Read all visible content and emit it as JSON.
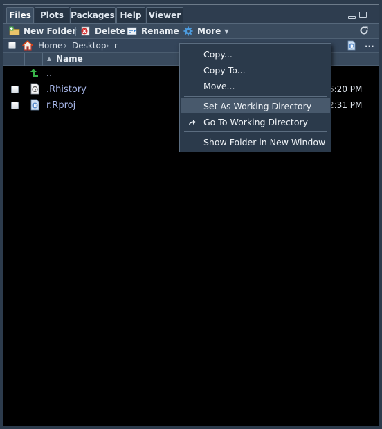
{
  "tabs": [
    {
      "label": "Files",
      "active": true
    },
    {
      "label": "Plots",
      "active": false
    },
    {
      "label": "Packages",
      "active": false
    },
    {
      "label": "Help",
      "active": false
    },
    {
      "label": "Viewer",
      "active": false
    }
  ],
  "toolbar": {
    "new_folder": "New Folder",
    "delete": "Delete",
    "rename": "Rename",
    "more": "More"
  },
  "breadcrumb": {
    "home": "Home",
    "desktop": "Desktop",
    "current": "r",
    "overflow": "..."
  },
  "columns": {
    "name": "Name"
  },
  "files": [
    {
      "name": "..",
      "icon": "up-arrow-icon",
      "modified": ""
    },
    {
      "name": ".Rhistory",
      "icon": "history-file-icon",
      "modified": "6:20 PM"
    },
    {
      "name": "r.Rproj",
      "icon": "rproj-file-icon",
      "modified": "2:31 PM"
    }
  ],
  "menu": {
    "copy": "Copy...",
    "copy_to": "Copy To...",
    "move": "Move...",
    "set_wd": "Set As Working Directory",
    "go_wd": "Go To Working Directory",
    "show_folder": "Show Folder in New Window"
  },
  "colors": {
    "pane_bg": "#000000",
    "toolbar_bg": "#3a4b5e",
    "menu_bg": "#2b3a4b",
    "menu_highlight": "#48596c",
    "file_link": "#a7b6e8",
    "up_arrow": "#39b54a"
  }
}
